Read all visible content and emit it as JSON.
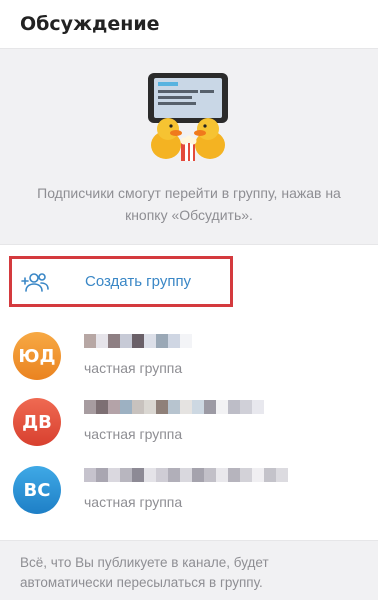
{
  "header": {
    "title": "Обсуждение"
  },
  "intro": {
    "text": "Подписчики смогут перейти в группу, нажав на кнопку «Обсудить»."
  },
  "create_group": {
    "label": "Создать группу",
    "icon": "add-user-icon",
    "accent": "#3a87c6"
  },
  "groups": [
    {
      "initials": "ЮД",
      "type": "частная группа",
      "avatar_color": "#f0942e"
    },
    {
      "initials": "ДВ",
      "type": "частная группа",
      "avatar_color": "#e0543f"
    },
    {
      "initials": "ВС",
      "type": "частная группа",
      "avatar_color": "#2f95d6"
    }
  ],
  "footer": {
    "text": "Всё, что Вы публикуете в канале, будет автоматически пересылаться в группу."
  }
}
